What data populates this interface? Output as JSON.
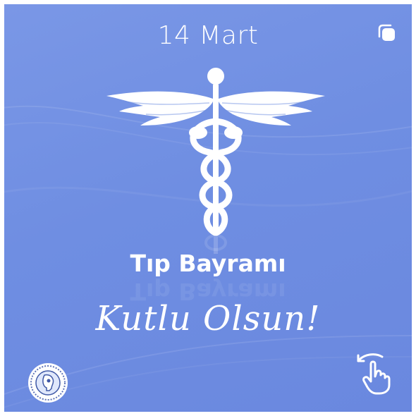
{
  "post": {
    "date": "14 Mart",
    "title": "Tıp Bayramı",
    "subtitle": "Kutlu Olsun!"
  },
  "icons": {
    "top_right": "multiple-images-icon",
    "emblem": "caduceus-icon",
    "bottom_left": "organization-logo-icon",
    "bottom_right": "swipe-hand-icon"
  },
  "colors": {
    "background": "#7090e2",
    "foreground": "#ffffff"
  }
}
